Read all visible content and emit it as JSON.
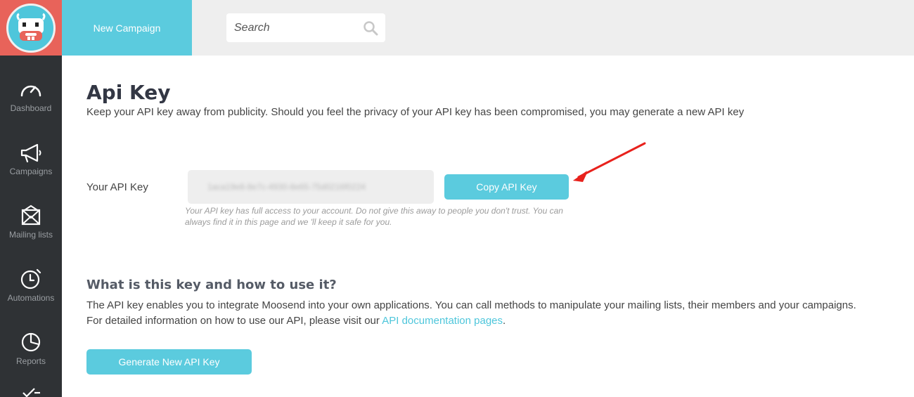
{
  "header": {
    "new_campaign_label": "New Campaign",
    "search_placeholder": "Search"
  },
  "sidebar": {
    "items": [
      {
        "label": "Dashboard",
        "icon": "speedometer-icon"
      },
      {
        "label": "Campaigns",
        "icon": "megaphone-icon"
      },
      {
        "label": "Mailing lists",
        "icon": "envelope-icon"
      },
      {
        "label": "Automations",
        "icon": "stopwatch-icon"
      },
      {
        "label": "Reports",
        "icon": "pie-chart-icon"
      }
    ]
  },
  "main": {
    "title": "Api Key",
    "subtitle": "Keep your API key away from publicity. Should you feel the privacy of your API key has been compromised, you may generate a new API key",
    "api_key_label": "Your API Key",
    "api_key_value": "1aca19e8-8e7c-4930-8e65-75d0216f0224",
    "copy_button": "Copy API Key",
    "hint": "Your API key has full access to your account. Do not give this away to people you don't trust. You can always find it in this page and we 'll keep it safe for you.",
    "section_title": "What is this key and how to use it?",
    "para1": "The API key enables you to integrate Moosend into your own applications. You can call methods to manipulate your mailing lists, their members and your campaigns.",
    "para2_prefix": "For detailed information on how to use our API, please visit our ",
    "para2_link": "API documentation pages",
    "para2_suffix": ".",
    "generate_button": "Generate New API Key"
  },
  "colors": {
    "accent": "#5bcbde",
    "logo_bg": "#e8635a",
    "sidebar_bg": "#2f3235",
    "arrow": "#e8211c"
  }
}
